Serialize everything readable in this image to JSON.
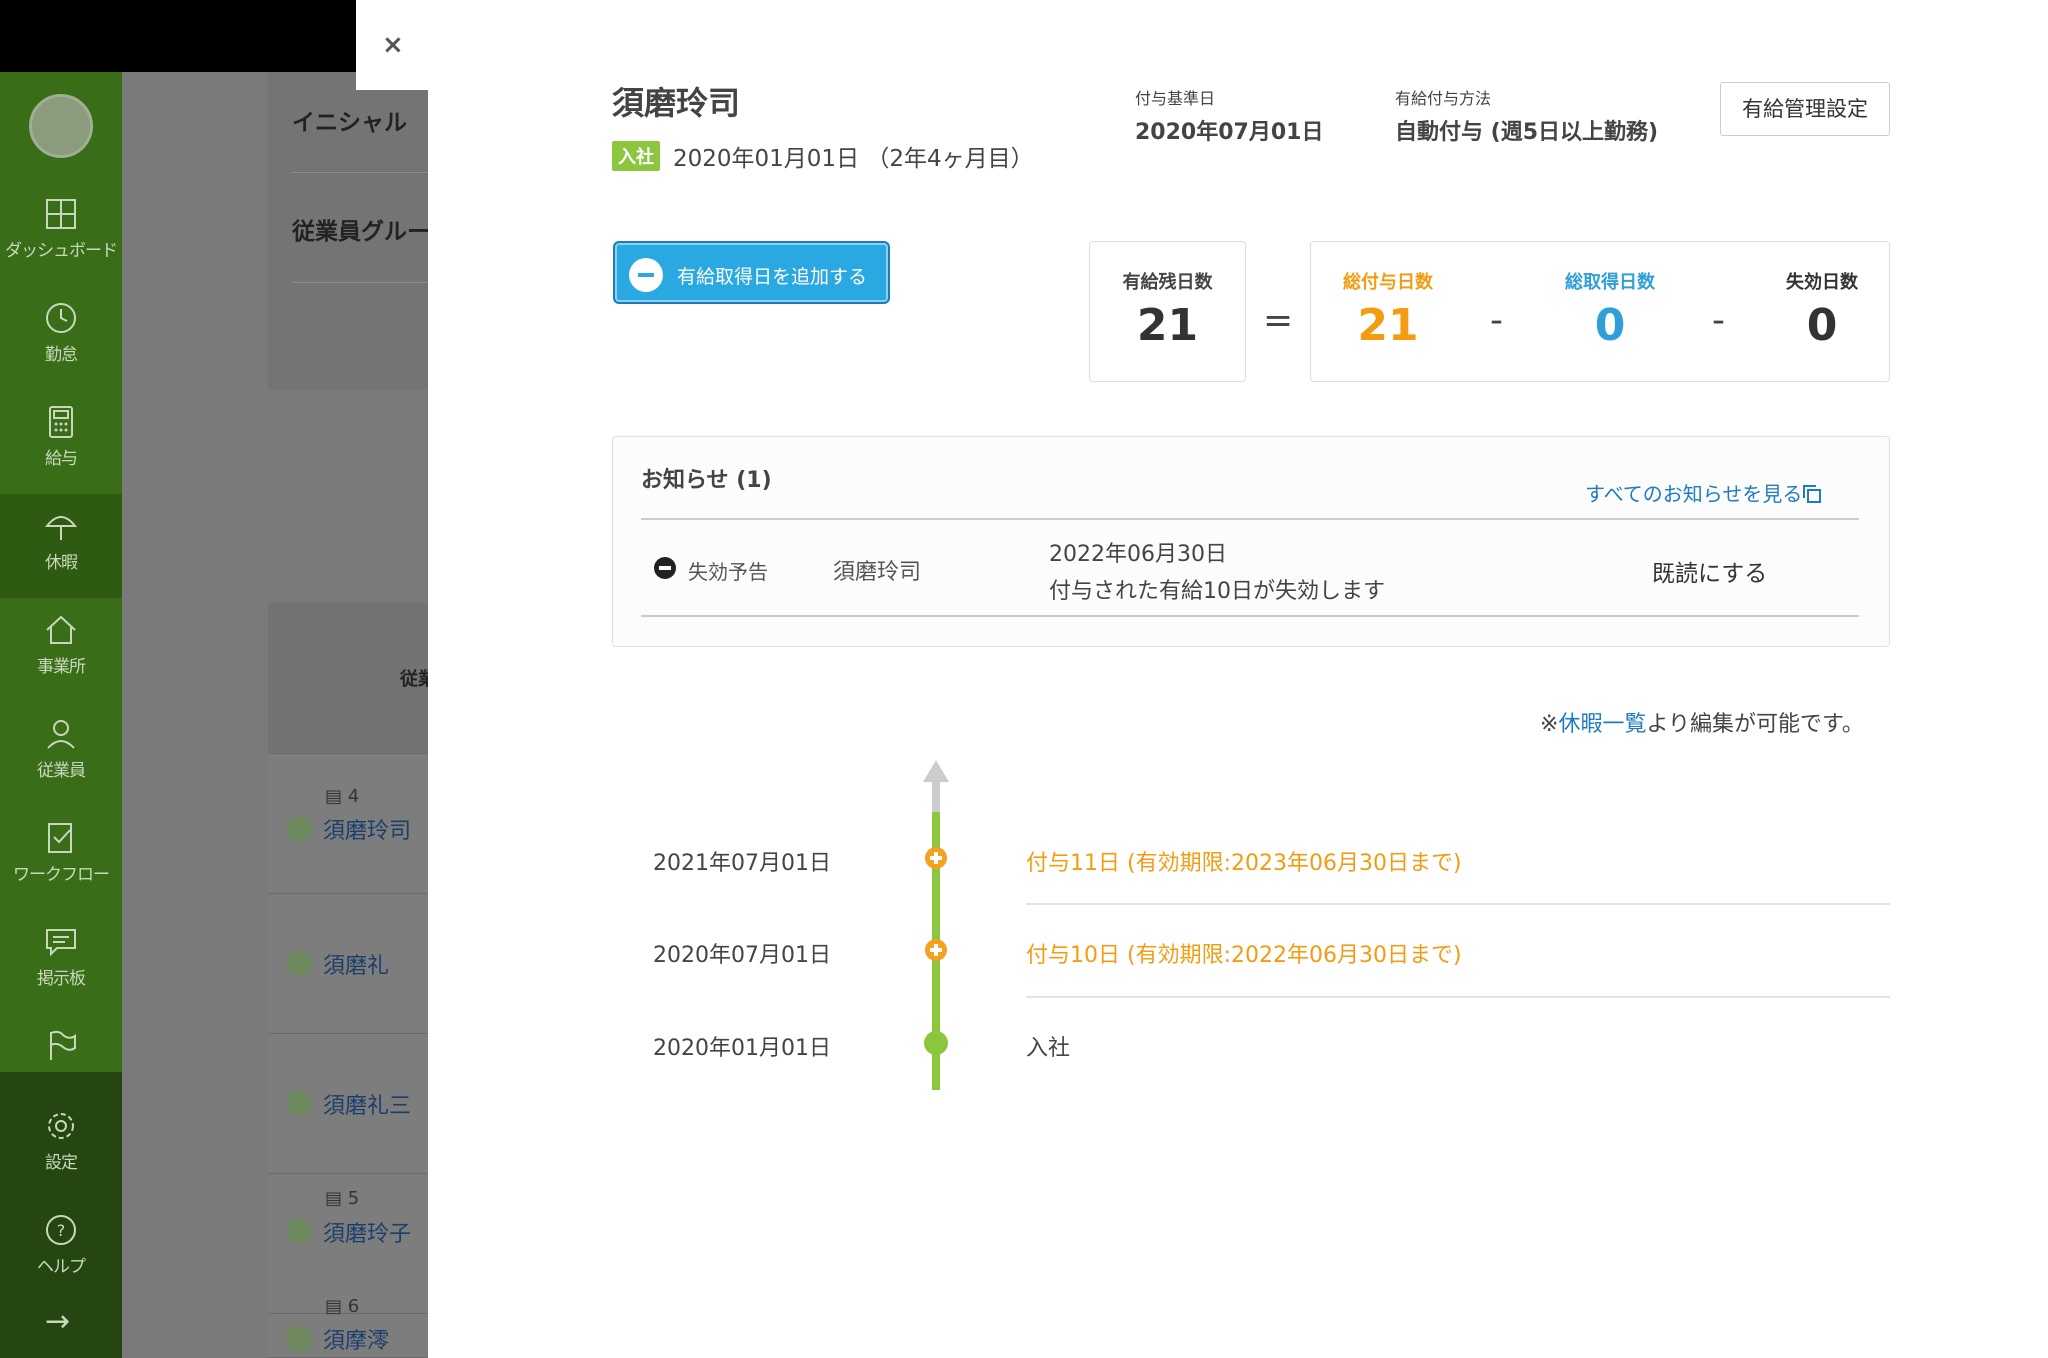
{
  "sidebar": {
    "items": [
      {
        "label": "ダッシュボード",
        "icon": "dashboard-icon"
      },
      {
        "label": "勤怠",
        "icon": "clock-icon"
      },
      {
        "label": "給与",
        "icon": "calculator-icon"
      },
      {
        "label": "休暇",
        "icon": "umbrella-icon"
      },
      {
        "label": "事業所",
        "icon": "home-icon"
      },
      {
        "label": "従業員",
        "icon": "person-icon"
      },
      {
        "label": "ワークフロー",
        "icon": "checklist-icon"
      },
      {
        "label": "掲示板",
        "icon": "chat-icon"
      },
      {
        "label": "",
        "icon": "flag-icon"
      },
      {
        "label": "設定",
        "icon": "gear-icon"
      },
      {
        "label": "ヘルプ",
        "icon": "help-icon"
      }
    ],
    "active_index": 3,
    "collapse": "→"
  },
  "background": {
    "filters": [
      "イニシャル",
      "従業員グルー"
    ],
    "table_header": "従業",
    "rows": [
      {
        "id": "4",
        "name": "須磨玲司"
      },
      {
        "id": "",
        "name": "須磨礼"
      },
      {
        "id": "",
        "name": "須磨礼三"
      },
      {
        "id": "5",
        "name": "須磨玲子"
      },
      {
        "id": "6",
        "name": "須摩澪"
      }
    ]
  },
  "modal": {
    "close": "×",
    "employee_name": "須磨玲司",
    "join_badge": "入社",
    "join_date": "2020年01月01日 （2年4ヶ月目）",
    "grant_base_label": "付与基準日",
    "grant_base_value": "2020年07月01日",
    "grant_method_label": "有給付与方法",
    "grant_method_value": "自動付与 (週5日以上勤務)",
    "settings_button": "有給管理設定",
    "add_button": "有給取得日を追加する",
    "stats": {
      "remaining": {
        "label": "有給残日数",
        "value": "21"
      },
      "equals": "=",
      "granted": {
        "label": "総付与日数",
        "value": "21"
      },
      "minus1": "-",
      "taken": {
        "label": "総取得日数",
        "value": "0"
      },
      "minus2": "-",
      "expired": {
        "label": "失効日数",
        "value": "0"
      }
    },
    "notice": {
      "title": "お知らせ (1)",
      "view_all": "すべてのお知らせを見る",
      "items": [
        {
          "type": "失効予告",
          "employee": "須磨玲司",
          "date": "2022年06月30日",
          "message": "付与された有給10日が失効します",
          "action": "既読にする"
        }
      ]
    },
    "edit_note": {
      "prefix": "※",
      "link": "休暇一覧",
      "suffix": "より編集が可能です。"
    },
    "timeline": [
      {
        "date": "2021年07月01日",
        "event": "付与11日 (有効期限:2023年06月30日まで)",
        "kind": "grant"
      },
      {
        "date": "2020年07月01日",
        "event": "付与10日 (有効期限:2022年06月30日まで)",
        "kind": "grant"
      },
      {
        "date": "2020年01月01日",
        "event": "入社",
        "kind": "join"
      }
    ]
  },
  "colors": {
    "orange": "#f39c12",
    "blue": "#2f9fd8",
    "green": "#8cc63f",
    "sidebar": "#3a6d17"
  }
}
